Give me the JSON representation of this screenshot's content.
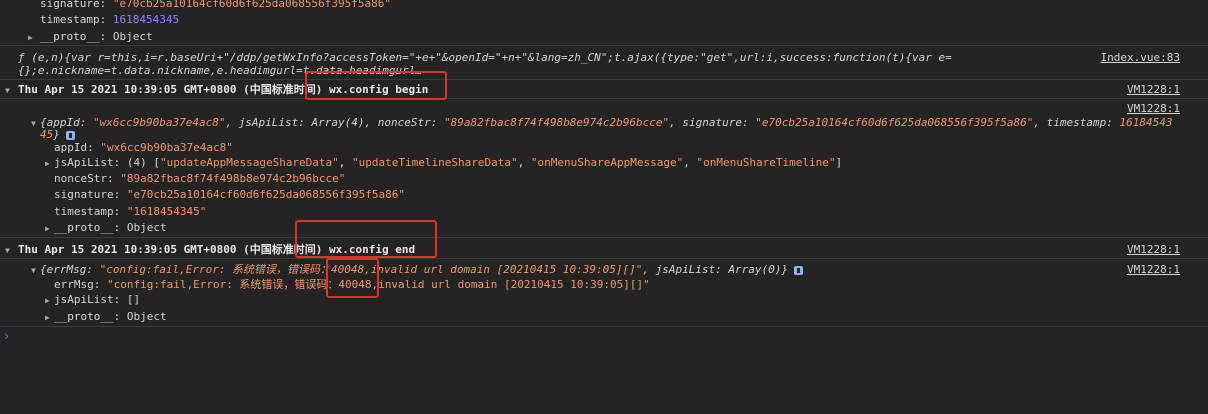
{
  "top_props": {
    "signature": {
      "key": "signature:",
      "value": "\"e70cb25a10164cf60d6f625da068556f395f5a86\""
    },
    "timestamp": {
      "key": "timestamp:",
      "value": "1618454345"
    },
    "proto": {
      "key": "__proto__:",
      "value": "Object"
    }
  },
  "fn_log": {
    "line1": "ƒ (e,n){var r=this,i=r.baseUri+\"/ddp/getWxInfo?accessToken=\"+e+\"&openId=\"+n+\"&lang=zh_CN\";t.ajax({type:\"get\",url:i,success:function(t){var e=",
    "line2": "{};e.nickname=t.data.nickname,e.headimgurl=t.data.headimgurl…",
    "source": "Index.vue:83"
  },
  "group1": {
    "header": "Thu Apr 15 2021 10:39:05 GMT+0800 (中国标准时间) wx.config begin",
    "source": "VM1228:1"
  },
  "config_log": {
    "source": "VM1228:1",
    "summary_open": "{appId: ",
    "summary_appid": "\"wx6cc9b90ba37e4ac8\"",
    "summary_mid1": ", jsApiList: Array(4), nonceStr: ",
    "summary_nonce": "\"89a82fbac8f74f498b8e974c2b96bcce\"",
    "summary_mid2": ", signature: ",
    "summary_sig": "\"e70cb25a10164cf60d6f625da068556f395f5a86\"",
    "summary_mid3": ", timestamp: ",
    "summary_ts_part1": "16184543",
    "summary_ts_part2": "45",
    "summary_close": "}",
    "appId": {
      "key": "appId:",
      "value": "\"wx6cc9b90ba37e4ac8\""
    },
    "jsApiList": {
      "key": "jsApiList:",
      "count": "(4) [",
      "items": [
        "\"updateAppMessageShareData\"",
        "\"updateTimelineShareData\"",
        "\"onMenuShareAppMessage\"",
        "\"onMenuShareTimeline\""
      ],
      "close": "]"
    },
    "nonceStr": {
      "key": "nonceStr:",
      "value": "\"89a82fbac8f74f498b8e974c2b96bcce\""
    },
    "signature": {
      "key": "signature:",
      "value": "\"e70cb25a10164cf60d6f625da068556f395f5a86\""
    },
    "timestamp": {
      "key": "timestamp:",
      "value": "\"1618454345\""
    },
    "proto": {
      "key": "__proto__:",
      "value": "Object"
    }
  },
  "group2": {
    "header": "Thu Apr 15 2021 10:39:05 GMT+0800 (中国标准时间) wx.config end",
    "source": "VM1228:1"
  },
  "err_log": {
    "source": "VM1228:1",
    "summary_open": "{errMsg: ",
    "summary_value": "\"config:fail,Error: 系统错误，错误码：40048,invalid url domain [20210415 10:39:05][]\"",
    "summary_mid": ", jsApiList: Array(0)",
    "summary_close": "}",
    "errMsg": {
      "key": "errMsg:",
      "value": "\"config:fail,Error: 系统错误，错误码：40048,invalid url domain [20210415 10:39:05][]\""
    },
    "jsApiList": {
      "key": "jsApiList:",
      "value": "[]"
    },
    "proto": {
      "key": "__proto__:",
      "value": "Object"
    }
  },
  "console_prompt": "›"
}
